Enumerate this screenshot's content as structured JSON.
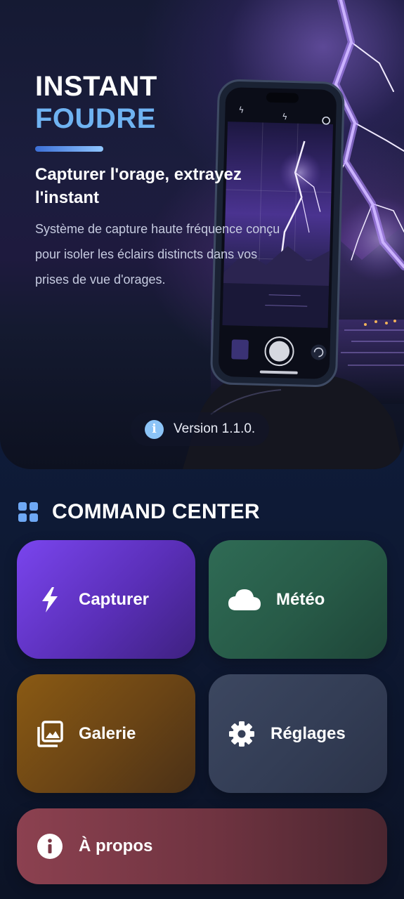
{
  "hero": {
    "title_line1": "INSTANT",
    "title_line2": "FOUDRE",
    "tagline": "Capturer l'orage, extrayez l'instant",
    "description": "Système de capture haute fréquence conçu pour isoler les éclairs distincts dans vos prises de vue d'orages.",
    "version": "Version 1.1.0."
  },
  "command_center": {
    "title": "COMMAND CENTER",
    "tiles": [
      {
        "label": "Capturer",
        "icon": "bolt-icon",
        "color": "#6b3ce0"
      },
      {
        "label": "Météo",
        "icon": "cloud-icon",
        "color": "#2a6350"
      },
      {
        "label": "Galerie",
        "icon": "gallery-icon",
        "color": "#7a5016"
      },
      {
        "label": "Réglages",
        "icon": "gear-icon",
        "color": "#374259"
      },
      {
        "label": "À propos",
        "icon": "info-icon",
        "color": "#7c3a48"
      }
    ]
  },
  "colors": {
    "accent": "#6fb3f2",
    "background": "#132244"
  }
}
